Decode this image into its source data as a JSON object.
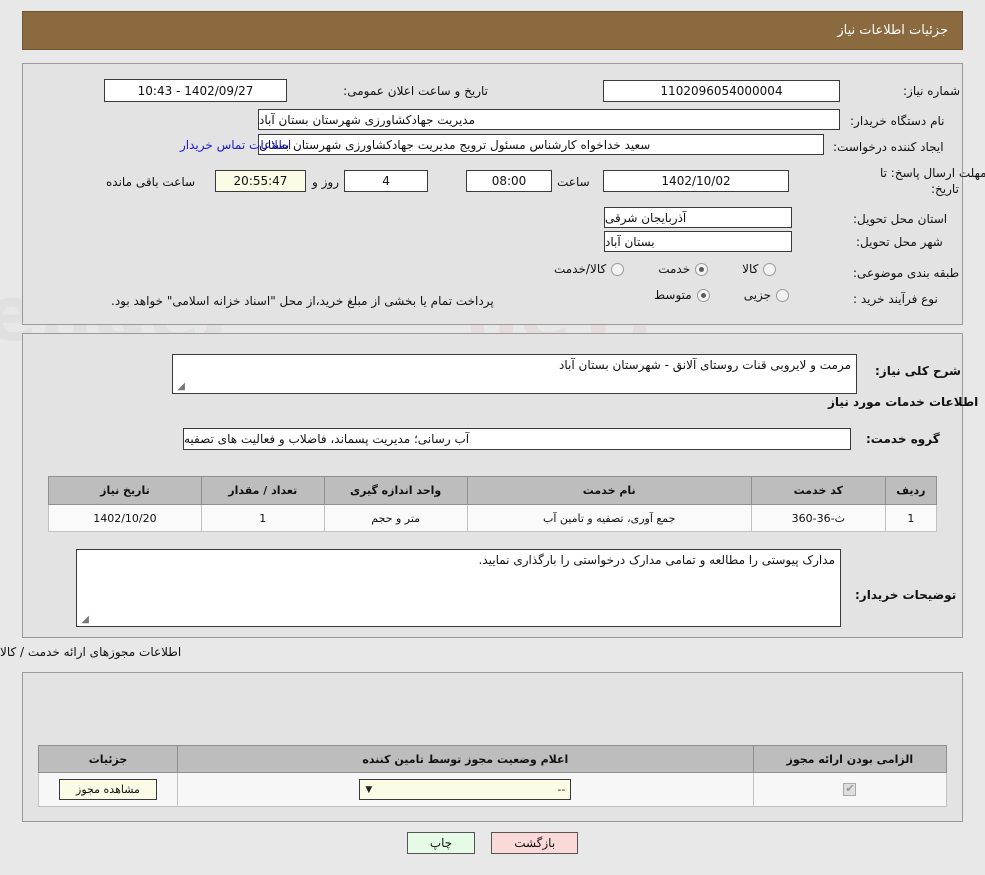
{
  "header": {
    "title": "جزئیات اطلاعات نیاز"
  },
  "top_form": {
    "need_number_label": "شماره نیاز:",
    "need_number_value": "1102096054000004",
    "announce_datetime_label": "تاریخ و ساعت اعلان عمومی:",
    "announce_datetime_value": "1402/09/27 - 10:43",
    "buyer_org_label": "نام دستگاه خریدار:",
    "buyer_org_value": "مدیریت جهادکشاورزی شهرستان بستان آباد",
    "requester_label": "ایجاد کننده درخواست:",
    "requester_value": "سعید خداخواه کارشناس مسئول ترویج مدیریت جهادکشاورزی شهرستان بستان",
    "buyer_contact_link": "اطلاعات تماس خریدار",
    "deadline_label_line1": "مهلت ارسال پاسخ: تا",
    "deadline_label_line2": "تاریخ:",
    "deadline_date": "1402/10/02",
    "hour_label": "ساعت",
    "deadline_time": "08:00",
    "days_remaining": "4",
    "days_word": "روز و",
    "time_remaining": "20:55:47",
    "remaining_suffix": "ساعت باقی مانده",
    "province_label": "استان محل تحویل:",
    "province_value": "آذربایجان شرقی",
    "city_label": "شهر محل تحویل:",
    "city_value": "بستان آباد",
    "category_label": "طبقه بندی موضوعی:",
    "category_options": [
      {
        "label": "کالا",
        "selected": false
      },
      {
        "label": "خدمت",
        "selected": true
      },
      {
        "label": "کالا/خدمت",
        "selected": false
      }
    ],
    "process_label": "نوع فرآیند خرید :",
    "process_options": [
      {
        "label": "جزیی",
        "selected": false
      },
      {
        "label": "متوسط",
        "selected": true
      }
    ],
    "payment_note": "پرداخت تمام یا بخشی از مبلغ خرید،از محل \"اسناد خزانه اسلامی\" خواهد بود."
  },
  "need_description": {
    "label": "شرح کلی نیاز:",
    "value": "مرمت و لایروبی قنات روستای آلانق - شهرستان بستان آباد"
  },
  "services_section": {
    "title": "اطلاعات خدمات مورد نیاز",
    "service_group_label": "گروه خدمت:",
    "service_group_value": "آب رسانی؛ مدیریت پسماند، فاضلاب و فعالیت های تصفیه",
    "table": {
      "columns": [
        "ردیف",
        "کد خدمت",
        "نام خدمت",
        "واحد اندازه گیری",
        "تعداد / مقدار",
        "تاریخ نیاز"
      ],
      "rows": [
        [
          "1",
          "ث-36-360",
          "جمع آوری، تصفیه و تامین آب",
          "متر و حجم",
          "1",
          "1402/10/20"
        ]
      ]
    }
  },
  "buyer_notes": {
    "label": "توضیحات خریدار:",
    "value": "مدارک پیوستی را مطالعه و تمامی مدارک درخواستی را بارگذاری نمایید."
  },
  "licenses_section": {
    "title": "اطلاعات مجوزهای ارائه خدمت / کالا",
    "table": {
      "columns": [
        "الزامی بودن ارائه مجوز",
        "اعلام وضعیت مجوز توسط تامین کننده",
        "جزئیات"
      ],
      "rows": [
        {
          "required": true,
          "status_value": "--",
          "details_button": "مشاهده مجوز"
        }
      ]
    }
  },
  "footer": {
    "print_label": "چاپ",
    "back_label": "بازگشت"
  },
  "colors": {
    "titlebar": "#8a6a3e",
    "panel": "#e3e3e3",
    "link": "#1b1ccd",
    "timer_bg": "#fbfbe6",
    "print_bg": "#e6fbe6",
    "back_bg": "#fbd9d9"
  }
}
